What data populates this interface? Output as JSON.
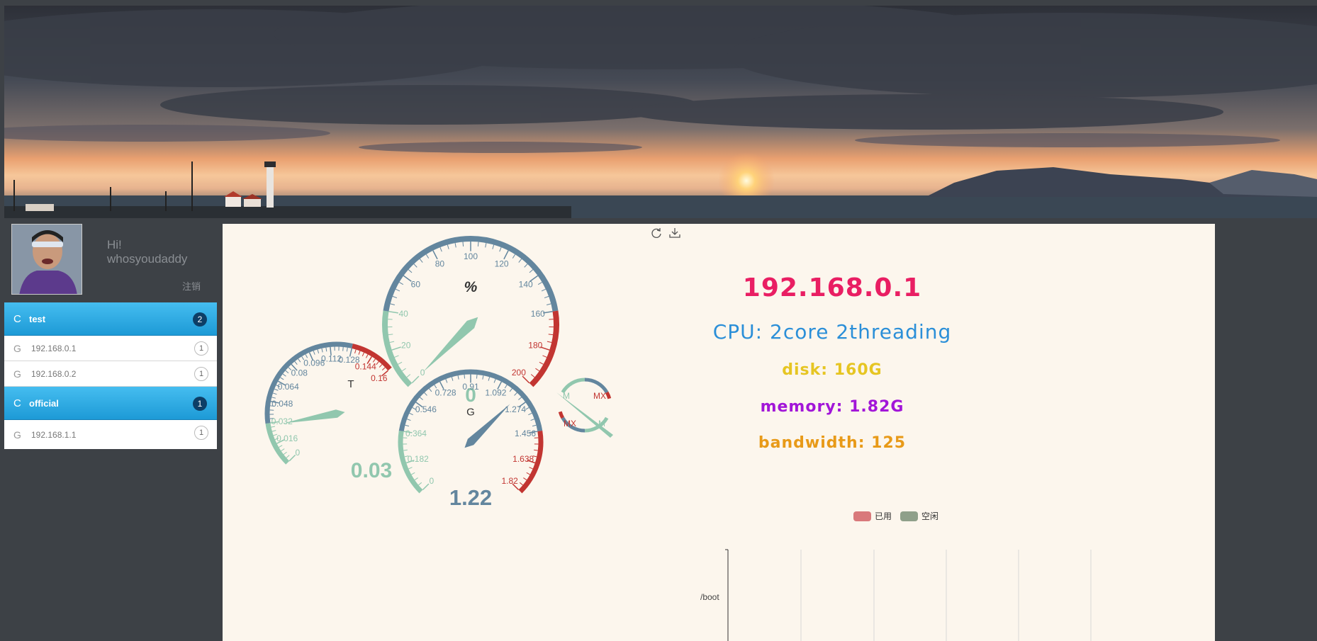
{
  "user": {
    "greeting": "Hi!",
    "username": "whosyoudaddy",
    "logout_label": "注销"
  },
  "sidebar": {
    "groups": [
      {
        "icon": "C",
        "label": "test",
        "count": "2",
        "hosts": [
          {
            "icon": "G",
            "label": "192.168.0.1",
            "count": "1"
          },
          {
            "icon": "G",
            "label": "192.168.0.2",
            "count": "1"
          }
        ]
      },
      {
        "icon": "C",
        "label": "official",
        "count": "1",
        "hosts": [
          {
            "icon": "G",
            "label": "192.168.1.1",
            "count": "1"
          }
        ]
      }
    ]
  },
  "toolbox": {
    "icons": [
      "refresh-icon",
      "download-icon"
    ]
  },
  "info": {
    "ip": "192.168.0.1",
    "cpu": "CPU: 2core 2threading",
    "disk": "disk: 160G",
    "memory": "memory: 1.82G",
    "bandwidth": "bandwidth: 125"
  },
  "legend": {
    "items": [
      {
        "label": "已用",
        "color": "#d9797b"
      },
      {
        "label": "空闲",
        "color": "#8fa08a"
      }
    ]
  },
  "disk_chart": {
    "category": "/boot"
  },
  "colors": {
    "gauge_low": "#91c7ae",
    "gauge_mid": "#63869e",
    "gauge_high": "#c23531",
    "sidebar_header": "#2aa8e0"
  },
  "chart_data": [
    {
      "type": "gauge",
      "name": "%",
      "min": 0,
      "max": 200,
      "split": 10,
      "ticks": [
        "0",
        "20",
        "40",
        "60",
        "80",
        "100",
        "120",
        "140",
        "160",
        "180",
        "200"
      ],
      "value": 0,
      "value_label": "0"
    },
    {
      "type": "gauge",
      "name": "T",
      "min": 0,
      "max": 0.16,
      "split": 10,
      "ticks": [
        "0",
        "0.016",
        "0.032",
        "0.048",
        "0.064",
        "0.08",
        "0.096",
        "0.112",
        "0.128",
        "0.144",
        "0.16"
      ],
      "value": 0.03,
      "value_label": "0.03"
    },
    {
      "type": "gauge",
      "name": "G",
      "min": 0,
      "max": 1.82,
      "split": 10,
      "ticks": [
        "0",
        "0.182",
        "0.364",
        "0.546",
        "0.728",
        "0.91",
        "1.092",
        "1.274",
        "1.456",
        "1.638",
        "1.82"
      ],
      "value": 1.22,
      "value_label": "1.22"
    },
    {
      "type": "gauge",
      "name": "",
      "labels": [
        "M",
        "MX",
        "MX",
        "M"
      ],
      "value": null
    }
  ]
}
